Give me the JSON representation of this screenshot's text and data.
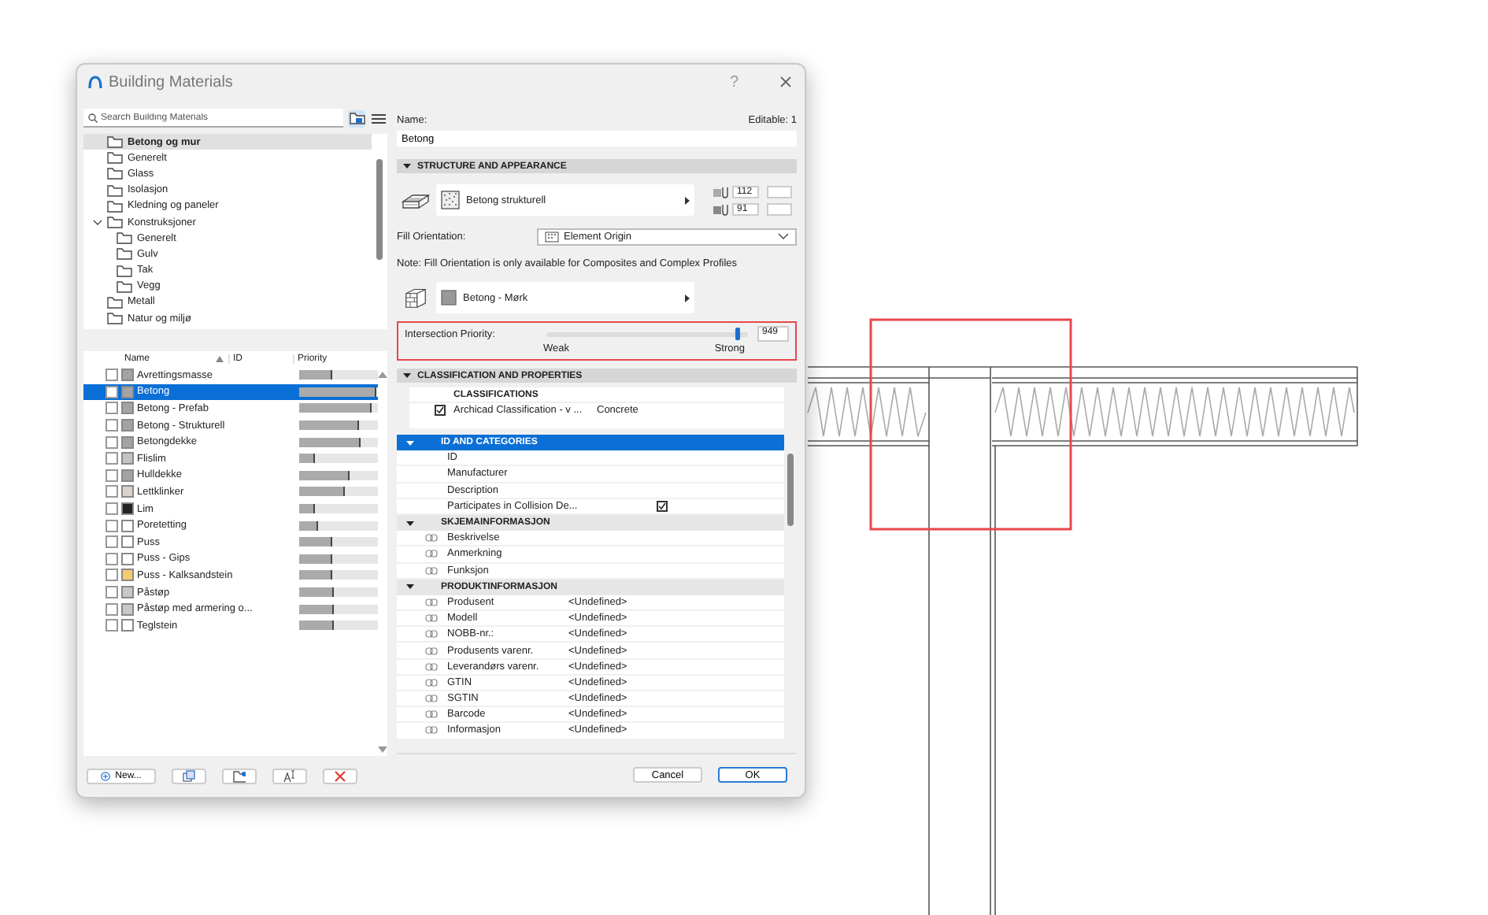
{
  "dialog": {
    "title": "Building Materials",
    "help": "?"
  },
  "search": {
    "placeholder": "Search Building Materials"
  },
  "folders": [
    {
      "label": "Betong og mur",
      "selected": true
    },
    {
      "label": "Generelt",
      "selected": false
    },
    {
      "label": "Glass",
      "selected": false
    },
    {
      "label": "Isolasjon",
      "selected": false
    },
    {
      "label": "Kledning og paneler",
      "selected": false
    },
    {
      "label": "Konstruksjoner",
      "selected": false,
      "expanded": true,
      "children": [
        {
          "label": "Generelt",
          "selected": false
        },
        {
          "label": "Gulv",
          "selected": false
        },
        {
          "label": "Tak",
          "selected": false
        },
        {
          "label": "Vegg",
          "selected": false
        }
      ]
    },
    {
      "label": "Metall",
      "selected": false
    },
    {
      "label": "Natur og miljø",
      "selected": false
    }
  ],
  "table": {
    "columns": [
      "Name",
      "ID",
      "Priority"
    ],
    "rows": [
      {
        "name": "Avrettingsmasse",
        "color": "#a3a3a3",
        "level": 0.41,
        "selected": false
      },
      {
        "name": "Betong",
        "color": "#a3a3a3",
        "level": 0.98,
        "selected": true
      },
      {
        "name": "Betong - Prefab",
        "color": "#a3a3a3",
        "level": 0.92,
        "selected": false
      },
      {
        "name": "Betong - Strukturell",
        "color": "#a3a3a3",
        "level": 0.76,
        "selected": false
      },
      {
        "name": "Betongdekke",
        "color": "#a3a3a3",
        "level": 0.77,
        "selected": false
      },
      {
        "name": "Flislim",
        "color": "#c4c4c4",
        "level": 0.2,
        "selected": false
      },
      {
        "name": "Hulldekke",
        "color": "#a3a3a3",
        "level": 0.63,
        "selected": false
      },
      {
        "name": "Lettklinker",
        "color": "#d9d2ca",
        "level": 0.58,
        "selected": false
      },
      {
        "name": "Lim",
        "color": "#222222",
        "level": 0.2,
        "selected": false
      },
      {
        "name": "Poretetting",
        "color": "#ffffff",
        "level": 0.24,
        "selected": false
      },
      {
        "name": "Puss",
        "color": "#ffffff",
        "level": 0.42,
        "selected": false
      },
      {
        "name": "Puss - Gips",
        "color": "#ffffff",
        "level": 0.42,
        "selected": false
      },
      {
        "name": "Puss - Kalksandstein",
        "color": "#f7cc70",
        "level": 0.42,
        "selected": false
      },
      {
        "name": "Påstøp",
        "color": "#c8c8c8",
        "level": 0.44,
        "selected": false
      },
      {
        "name": "Påstøp med armering o...",
        "color": "#c8c8c8",
        "level": 0.44,
        "selected": false
      },
      {
        "name": "Teglstein",
        "color": "#ffffff",
        "level": 0.43,
        "selected": false
      }
    ]
  },
  "new_button": "New...",
  "name_label": "Name:",
  "editable": "Editable: 1",
  "name_value": "Betong",
  "structure": {
    "title": "STRUCTURE AND APPEARANCE",
    "expanded": true,
    "cut_fill": "Betong strukturell",
    "pen_fill": "112",
    "pen_background": "91",
    "fill_orientation_label": "Fill Orientation:",
    "fill_orientation": "Element Origin",
    "note": "Note: Fill Orientation is only available for Composites and Complex Profiles",
    "surface": "Betong - Mørk",
    "priority": {
      "label": "Intersection Priority:",
      "level": 0.95,
      "value": "949",
      "min_label": "Weak",
      "max_label": "Strong"
    }
  },
  "classification": {
    "title": "CLASSIFICATION AND PROPERTIES",
    "expanded": true,
    "header": "CLASSIFICATIONS",
    "items": [
      {
        "system": "Archicad Classification - v ...",
        "value": "Concrete",
        "checked": true
      }
    ]
  },
  "property_groups": [
    {
      "title": "ID AND CATEGORIES",
      "selected": true,
      "expanded": true,
      "rows": [
        {
          "kind": "plain",
          "name": "ID"
        },
        {
          "kind": "plain",
          "name": "Manufacturer"
        },
        {
          "kind": "plain",
          "name": "Description"
        },
        {
          "kind": "checkbox",
          "name": "Participates in Collision De...",
          "checked": true
        }
      ]
    },
    {
      "title": "SKJEMAINFORMASJON",
      "selected": false,
      "expanded": true,
      "rows": [
        {
          "kind": "linked",
          "name": "Beskrivelse"
        },
        {
          "kind": "linked",
          "name": "Anmerkning"
        },
        {
          "kind": "linked",
          "name": "Funksjon"
        }
      ]
    },
    {
      "title": "PRODUKTINFORMASJON",
      "selected": false,
      "expanded": true,
      "rows": [
        {
          "kind": "linked",
          "name": "Produsent",
          "value": "<Undefined>"
        },
        {
          "kind": "linked",
          "name": "Modell",
          "value": "<Undefined>"
        },
        {
          "kind": "linked",
          "name": "NOBB-nr.:",
          "value": "<Undefined>"
        },
        {
          "kind": "linked",
          "name": "Produsents varenr.",
          "value": "<Undefined>"
        },
        {
          "kind": "linked",
          "name": "Leverandørs varenr.",
          "value": "<Undefined>"
        },
        {
          "kind": "linked",
          "name": "GTIN",
          "value": "<Undefined>"
        },
        {
          "kind": "linked",
          "name": "SGTIN",
          "value": "<Undefined>"
        },
        {
          "kind": "linked",
          "name": "Barcode",
          "value": "<Undefined>"
        },
        {
          "kind": "linked",
          "name": "Informasjon",
          "value": "<Undefined>"
        }
      ]
    }
  ],
  "buttons": {
    "cancel": "Cancel",
    "ok": "OK"
  }
}
